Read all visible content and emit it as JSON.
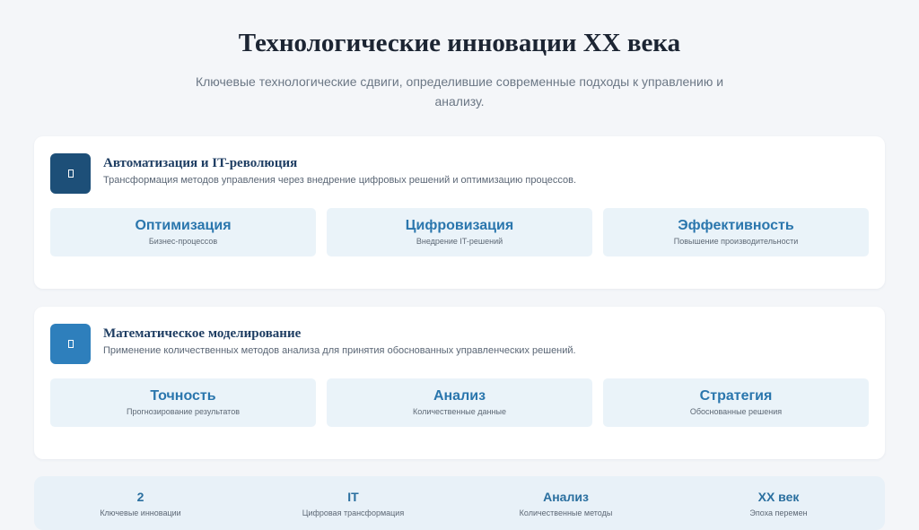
{
  "header": {
    "title": "Технологические инновации XX века",
    "subtitle": "Ключевые технологические сдвиги, определившие современные подходы к управлению и анализу."
  },
  "sections": [
    {
      "title": "Автоматизация и IT-революция",
      "description": "Трансформация методов управления через внедрение цифровых решений и оптимизацию процессов.",
      "icon": "document-icon",
      "icon_color": "#1d4f78",
      "tiles": [
        {
          "title": "Оптимизация",
          "subtitle": "Бизнес-процессов"
        },
        {
          "title": "Цифровизация",
          "subtitle": "Внедрение IT-решений"
        },
        {
          "title": "Эффективность",
          "subtitle": "Повышение производительности"
        }
      ]
    },
    {
      "title": "Математическое моделирование",
      "description": "Применение количественных методов анализа для принятия обоснованных управленческих решений.",
      "icon": "document-icon",
      "icon_color": "#2e7fbc",
      "tiles": [
        {
          "title": "Точность",
          "subtitle": "Прогнозирование результатов"
        },
        {
          "title": "Анализ",
          "subtitle": "Количественные данные"
        },
        {
          "title": "Стратегия",
          "subtitle": "Обоснованные решения"
        }
      ]
    }
  ],
  "stats": [
    {
      "value": "2",
      "label": "Ключевые инновации"
    },
    {
      "value": "IT",
      "label": "Цифровая трансформация"
    },
    {
      "value": "Анализ",
      "label": "Количественные методы"
    },
    {
      "value": "XX век",
      "label": "Эпоха перемен"
    }
  ]
}
